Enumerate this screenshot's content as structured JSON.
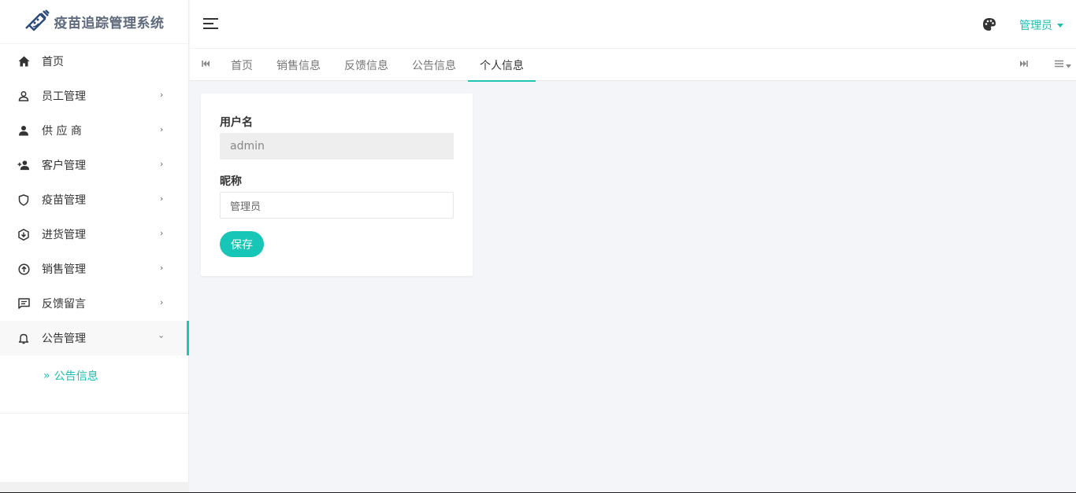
{
  "app": {
    "title": "疫苗追踪管理系统"
  },
  "sidebar": {
    "items": [
      {
        "label": "首页",
        "icon": "home-icon",
        "has_arrow": false
      },
      {
        "label": "员工管理",
        "icon": "user-outline-icon",
        "has_arrow": true
      },
      {
        "label": "供 应 商",
        "icon": "person-icon",
        "has_arrow": true
      },
      {
        "label": "客户管理",
        "icon": "person-add-icon",
        "has_arrow": true
      },
      {
        "label": "疫苗管理",
        "icon": "shield-icon",
        "has_arrow": true
      },
      {
        "label": "进货管理",
        "icon": "box-down-icon",
        "has_arrow": true
      },
      {
        "label": "销售管理",
        "icon": "upload-circle-icon",
        "has_arrow": true
      },
      {
        "label": "反馈留言",
        "icon": "message-icon",
        "has_arrow": true
      },
      {
        "label": "公告管理",
        "icon": "bell-icon",
        "has_arrow": true,
        "expanded": true
      }
    ],
    "submenu": {
      "label": "公告信息",
      "prefix": "»"
    }
  },
  "header": {
    "user_label": "管理员"
  },
  "tabs": {
    "items": [
      "首页",
      "销售信息",
      "反馈信息",
      "公告信息",
      "个人信息"
    ],
    "active_index": 4
  },
  "form": {
    "username_label": "用户名",
    "username_value": "admin",
    "nickname_label": "昵称",
    "nickname_value": "管理员",
    "save_label": "保存"
  },
  "colors": {
    "accent": "#1fc6b6",
    "logo_text": "#5f6a7d"
  }
}
